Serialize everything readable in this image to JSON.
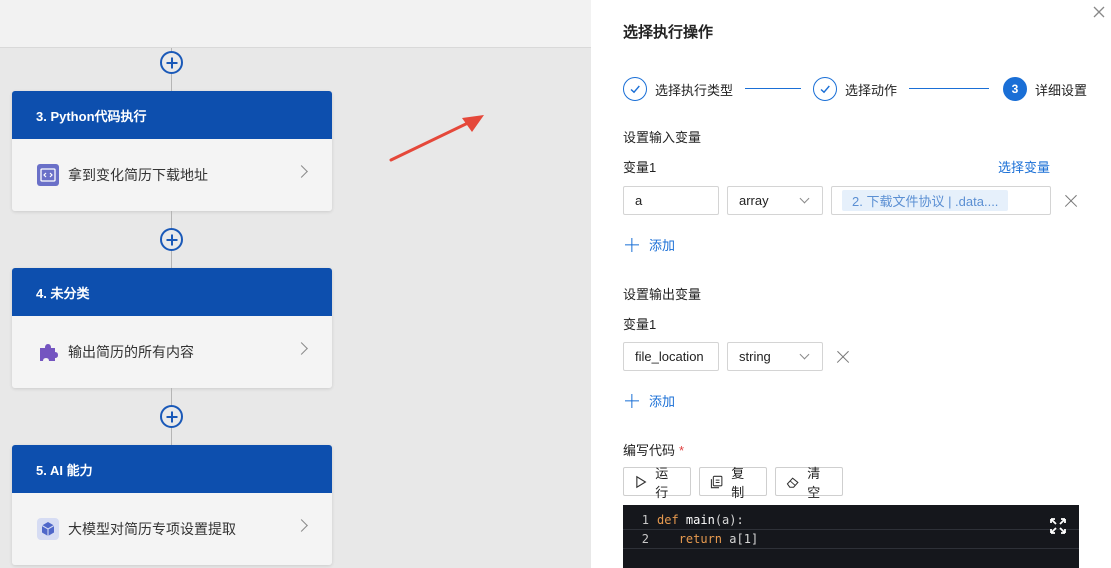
{
  "canvas": {
    "nodes": [
      {
        "header": "3. Python代码执行",
        "body": "拿到变化简历下载地址",
        "icon": "code-icon"
      },
      {
        "header": "4. 未分类",
        "body": "输出简历的所有内容",
        "icon": "puzzle-icon"
      },
      {
        "header": "5. AI 能力",
        "body": "大模型对简历专项设置提取",
        "icon": "cube-icon"
      }
    ]
  },
  "panel": {
    "title": "选择执行操作",
    "steps": [
      {
        "label": "选择执行类型",
        "state": "done"
      },
      {
        "label": "选择动作",
        "state": "done"
      },
      {
        "number": "3",
        "label": "详细设置",
        "state": "active"
      }
    ],
    "input_section": {
      "title": "设置输入变量",
      "var_label": "变量1",
      "select_var_link": "选择变量",
      "var_name": "a",
      "var_type": "array",
      "var_value_tag": "2. 下载文件协议 | .data....",
      "add_label": "添加"
    },
    "output_section": {
      "title": "设置输出变量",
      "var_label": "变量1",
      "var_name": "file_location",
      "var_type": "string",
      "add_label": "添加"
    },
    "code_section": {
      "title": "编写代码",
      "required_mark": "*",
      "run_label": "运行",
      "copy_label": "复制",
      "clear_label": "清空",
      "lines": [
        {
          "num": "1",
          "kw": "def",
          "fn": "main",
          "rest": "(a):"
        },
        {
          "num": "2",
          "indent": "   ",
          "kw": "return",
          "rest": " a[1]"
        }
      ]
    }
  },
  "colors": {
    "accent": "#1a6fd6",
    "node_header": "#0d4fae",
    "arrow": "#e5483a"
  }
}
